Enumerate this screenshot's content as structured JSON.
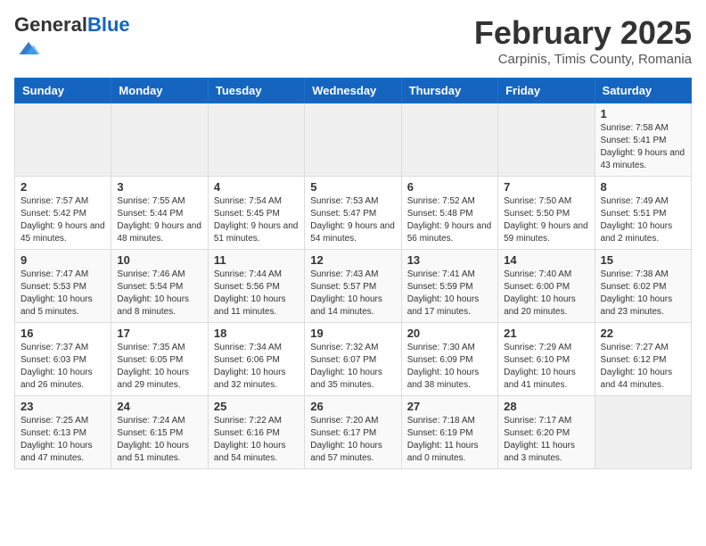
{
  "header": {
    "logo_general": "General",
    "logo_blue": "Blue",
    "month_title": "February 2025",
    "location": "Carpinis, Timis County, Romania"
  },
  "calendar": {
    "days_of_week": [
      "Sunday",
      "Monday",
      "Tuesday",
      "Wednesday",
      "Thursday",
      "Friday",
      "Saturday"
    ],
    "weeks": [
      [
        {
          "day": "",
          "info": ""
        },
        {
          "day": "",
          "info": ""
        },
        {
          "day": "",
          "info": ""
        },
        {
          "day": "",
          "info": ""
        },
        {
          "day": "",
          "info": ""
        },
        {
          "day": "",
          "info": ""
        },
        {
          "day": "1",
          "info": "Sunrise: 7:58 AM\nSunset: 5:41 PM\nDaylight: 9 hours and 43 minutes."
        }
      ],
      [
        {
          "day": "2",
          "info": "Sunrise: 7:57 AM\nSunset: 5:42 PM\nDaylight: 9 hours and 45 minutes."
        },
        {
          "day": "3",
          "info": "Sunrise: 7:55 AM\nSunset: 5:44 PM\nDaylight: 9 hours and 48 minutes."
        },
        {
          "day": "4",
          "info": "Sunrise: 7:54 AM\nSunset: 5:45 PM\nDaylight: 9 hours and 51 minutes."
        },
        {
          "day": "5",
          "info": "Sunrise: 7:53 AM\nSunset: 5:47 PM\nDaylight: 9 hours and 54 minutes."
        },
        {
          "day": "6",
          "info": "Sunrise: 7:52 AM\nSunset: 5:48 PM\nDaylight: 9 hours and 56 minutes."
        },
        {
          "day": "7",
          "info": "Sunrise: 7:50 AM\nSunset: 5:50 PM\nDaylight: 9 hours and 59 minutes."
        },
        {
          "day": "8",
          "info": "Sunrise: 7:49 AM\nSunset: 5:51 PM\nDaylight: 10 hours and 2 minutes."
        }
      ],
      [
        {
          "day": "9",
          "info": "Sunrise: 7:47 AM\nSunset: 5:53 PM\nDaylight: 10 hours and 5 minutes."
        },
        {
          "day": "10",
          "info": "Sunrise: 7:46 AM\nSunset: 5:54 PM\nDaylight: 10 hours and 8 minutes."
        },
        {
          "day": "11",
          "info": "Sunrise: 7:44 AM\nSunset: 5:56 PM\nDaylight: 10 hours and 11 minutes."
        },
        {
          "day": "12",
          "info": "Sunrise: 7:43 AM\nSunset: 5:57 PM\nDaylight: 10 hours and 14 minutes."
        },
        {
          "day": "13",
          "info": "Sunrise: 7:41 AM\nSunset: 5:59 PM\nDaylight: 10 hours and 17 minutes."
        },
        {
          "day": "14",
          "info": "Sunrise: 7:40 AM\nSunset: 6:00 PM\nDaylight: 10 hours and 20 minutes."
        },
        {
          "day": "15",
          "info": "Sunrise: 7:38 AM\nSunset: 6:02 PM\nDaylight: 10 hours and 23 minutes."
        }
      ],
      [
        {
          "day": "16",
          "info": "Sunrise: 7:37 AM\nSunset: 6:03 PM\nDaylight: 10 hours and 26 minutes."
        },
        {
          "day": "17",
          "info": "Sunrise: 7:35 AM\nSunset: 6:05 PM\nDaylight: 10 hours and 29 minutes."
        },
        {
          "day": "18",
          "info": "Sunrise: 7:34 AM\nSunset: 6:06 PM\nDaylight: 10 hours and 32 minutes."
        },
        {
          "day": "19",
          "info": "Sunrise: 7:32 AM\nSunset: 6:07 PM\nDaylight: 10 hours and 35 minutes."
        },
        {
          "day": "20",
          "info": "Sunrise: 7:30 AM\nSunset: 6:09 PM\nDaylight: 10 hours and 38 minutes."
        },
        {
          "day": "21",
          "info": "Sunrise: 7:29 AM\nSunset: 6:10 PM\nDaylight: 10 hours and 41 minutes."
        },
        {
          "day": "22",
          "info": "Sunrise: 7:27 AM\nSunset: 6:12 PM\nDaylight: 10 hours and 44 minutes."
        }
      ],
      [
        {
          "day": "23",
          "info": "Sunrise: 7:25 AM\nSunset: 6:13 PM\nDaylight: 10 hours and 47 minutes."
        },
        {
          "day": "24",
          "info": "Sunrise: 7:24 AM\nSunset: 6:15 PM\nDaylight: 10 hours and 51 minutes."
        },
        {
          "day": "25",
          "info": "Sunrise: 7:22 AM\nSunset: 6:16 PM\nDaylight: 10 hours and 54 minutes."
        },
        {
          "day": "26",
          "info": "Sunrise: 7:20 AM\nSunset: 6:17 PM\nDaylight: 10 hours and 57 minutes."
        },
        {
          "day": "27",
          "info": "Sunrise: 7:18 AM\nSunset: 6:19 PM\nDaylight: 11 hours and 0 minutes."
        },
        {
          "day": "28",
          "info": "Sunrise: 7:17 AM\nSunset: 6:20 PM\nDaylight: 11 hours and 3 minutes."
        },
        {
          "day": "",
          "info": ""
        }
      ]
    ]
  }
}
